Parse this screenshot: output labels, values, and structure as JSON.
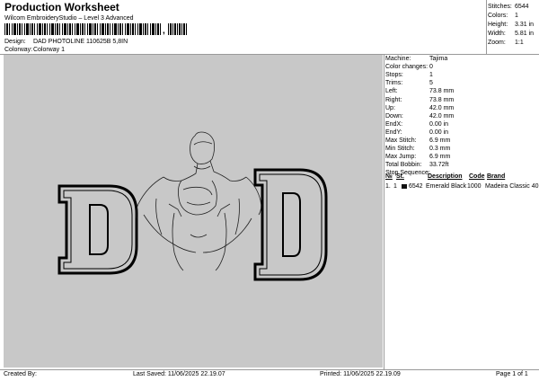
{
  "header": {
    "title": "Production Worksheet",
    "software": "Wilcom EmbroideryStudio – Level 3 Advanced",
    "design_label": "Design:",
    "design_value": "DAD PHOTOLINE 110625B 5,8IN",
    "colorway_label": "Colorway:",
    "colorway_value": "Colorway 1"
  },
  "summary": [
    {
      "label": "Stitches:",
      "value": "6544"
    },
    {
      "label": "Colors:",
      "value": "1"
    },
    {
      "label": "Height:",
      "value": "3.31 in"
    },
    {
      "label": "Width:",
      "value": "5.81 in"
    },
    {
      "label": "Zoom:",
      "value": "1:1"
    }
  ],
  "machine_info": [
    {
      "label": "Machine:",
      "value": "Tajima"
    },
    {
      "label": "Color changes:",
      "value": "0"
    },
    {
      "label": "Stops:",
      "value": "1"
    },
    {
      "label": "Trims:",
      "value": "5"
    },
    {
      "label": "Left:",
      "value": "73.8 mm"
    },
    {
      "label": "Right:",
      "value": "73.8 mm"
    },
    {
      "label": "Up:",
      "value": "42.0 mm"
    },
    {
      "label": "Down:",
      "value": "42.0 mm"
    },
    {
      "label": "EndX:",
      "value": "0.00 in"
    },
    {
      "label": "EndY:",
      "value": "0.00 in"
    },
    {
      "label": "Max Stitch:",
      "value": "6.9 mm"
    },
    {
      "label": "Min Stitch:",
      "value": "0.3 mm"
    },
    {
      "label": "Max Jump:",
      "value": "6.9 mm"
    },
    {
      "label": "Total Bobbin:",
      "value": "33.72ft"
    }
  ],
  "stop_sequence": {
    "title": "Stop Sequence:",
    "columns": [
      "№",
      "St.",
      "Description",
      "Code",
      "Brand"
    ],
    "rows": [
      {
        "num": "1.",
        "stop": "1",
        "color": "#111111",
        "stitches": "6542",
        "description": "Emerald Black",
        "code": "1000",
        "brand": "Madeira Classic 40"
      }
    ]
  },
  "footer": {
    "created_by": "Created By:",
    "last_saved": "Last Saved: 11/06/2025 22.19.07",
    "printed": "Printed: 11/06/2025 22.19.09",
    "page": "Page 1 of 1"
  },
  "colors": {
    "canvas_bg": "#c8c8c8",
    "letter_fill": "#c8c8c8",
    "letter_outline": "#000000"
  }
}
